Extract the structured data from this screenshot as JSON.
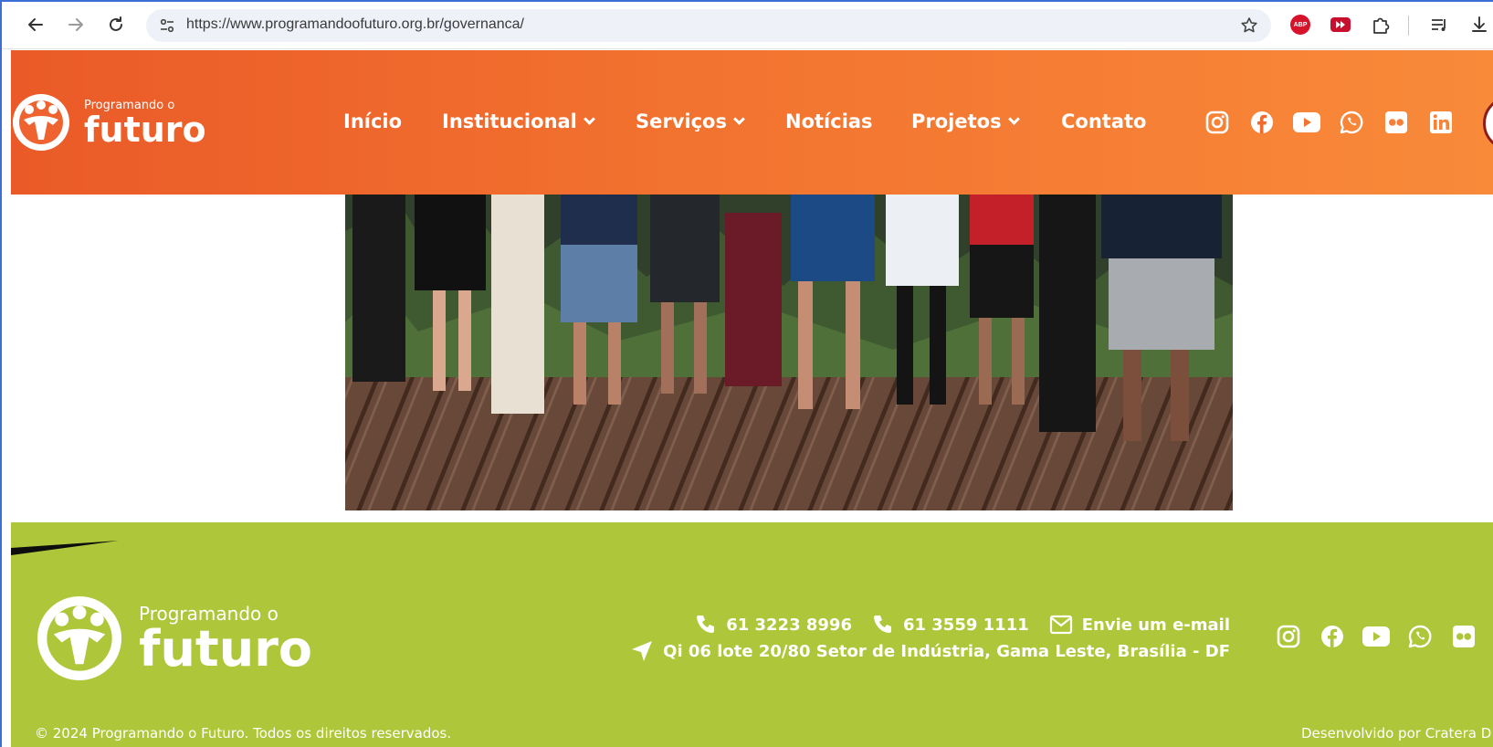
{
  "browser": {
    "url": "https://www.programandoofuturo.org.br/governanca/",
    "extensions": [
      "adblock-plus-icon",
      "youtube-extension-icon",
      "extensions-puzzle-icon"
    ],
    "abp_label": "ABP"
  },
  "site": {
    "logo": {
      "small": "Programando o",
      "big": "futuro"
    },
    "menu": [
      {
        "label": "Início",
        "dropdown": false
      },
      {
        "label": "Institucional",
        "dropdown": true
      },
      {
        "label": "Serviços",
        "dropdown": true
      },
      {
        "label": "Notícias",
        "dropdown": false
      },
      {
        "label": "Projetos",
        "dropdown": true
      },
      {
        "label": "Contato",
        "dropdown": false
      }
    ],
    "header_social": [
      "instagram-icon",
      "facebook-icon",
      "youtube-icon",
      "whatsapp-icon",
      "flickr-icon",
      "linkedin-icon"
    ],
    "colors": {
      "header_start": "#ea5a28",
      "header_end": "#f98a3a",
      "footer": "#aec63a"
    }
  },
  "footer": {
    "logo": {
      "small": "Programando o",
      "big": "futuro"
    },
    "phone1": "61 3223 8996",
    "phone2": "61 3559 1111",
    "email_label": "Envie um e-mail",
    "address": "Qi 06 lote 20/80 Setor de Indústria, Gama Leste, Brasília - DF",
    "social": [
      "instagram-icon",
      "facebook-icon",
      "youtube-icon",
      "whatsapp-icon",
      "flickr-icon"
    ],
    "copyright": "© 2024 Programando o Futuro. Todos os direitos reservados.",
    "developer": "Desenvolvido por Cratera D"
  }
}
